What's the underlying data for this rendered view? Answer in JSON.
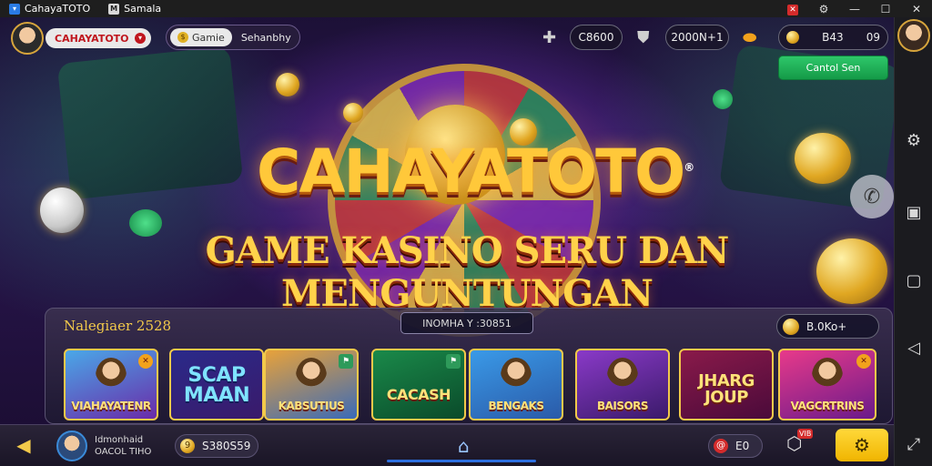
{
  "titlebar": {
    "app_tab": "CahayaTOTO",
    "second_tab_icon": "M",
    "second_tab": "Samala",
    "controls": [
      "record-icon",
      "settings-icon",
      "minimize-icon",
      "maximize-icon",
      "close-icon"
    ]
  },
  "header": {
    "player_name": "CAHAYATOTO",
    "game_pill_first": "Gamie",
    "game_pill_second": "Sehanbhy",
    "hud_gems": "C8600",
    "hud_points": "2000N+1",
    "hud_coins_label": "B43",
    "hud_coins_value": "09",
    "claim_button": "Cantol Sen"
  },
  "headline": {
    "brand": "CAHAYATOTO",
    "brand_mark": "®",
    "tagline": "GAME KASINO SERU DAN MENGUNTUNGAN"
  },
  "panel": {
    "label": "Nalegiaer 2528",
    "center_text": "INOMHA Y :30851",
    "balance": "B.0Ko+",
    "tiles": [
      {
        "title": "VIAHAYATENR",
        "badge": "✕"
      },
      {
        "title": "SCAP MAAN",
        "badge": ""
      },
      {
        "title": "KABSUTIUS",
        "badge": "⚑"
      },
      {
        "title": "CACASH",
        "badge": "⚑"
      },
      {
        "title": "BENGAKS",
        "badge": ""
      },
      {
        "title": "BAISORS",
        "badge": ""
      },
      {
        "title": "JHARG JOUP",
        "badge": ""
      },
      {
        "title": "VAGCRTRINS",
        "badge": "✕"
      }
    ]
  },
  "bottombar": {
    "user_line1": "Idmonhaid",
    "user_line2": "OACOL TIHO",
    "balance": "S380S59",
    "balance_icon": "9",
    "counter_icon": "@",
    "counter": "E0",
    "gift_badge": "VIB"
  },
  "colors": {
    "accent_gold": "#f2c94a",
    "claim_green": "#1fae56",
    "brand_red": "#c0161e",
    "home_blue": "#2d6fe0"
  }
}
